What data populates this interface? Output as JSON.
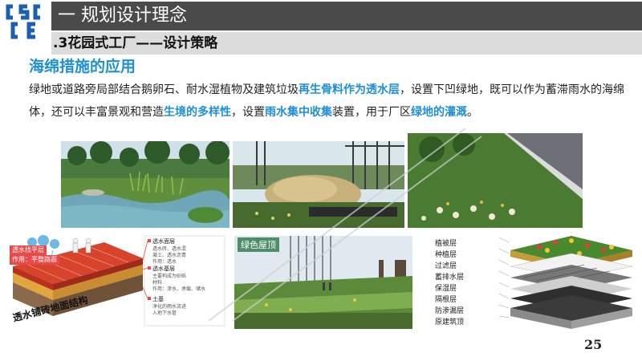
{
  "logo": {
    "text": "CSCEC"
  },
  "header": {
    "title": "一 规划设计理念"
  },
  "subheader": {
    "title": ".3花园式工厂——设计策略"
  },
  "section": {
    "title": "海绵措施的应用"
  },
  "paragraph": {
    "p1": "绿地或道路旁局部结合鹅卵石、耐水湿植物及建筑垃圾",
    "h1": "再生骨料作为透水层",
    "p2": "，设置下凹绿地，既可以作为蓄滞雨水的海绵体，还可以丰富景观和营造",
    "h2": "生境的多样性",
    "p3": "，设置",
    "h3": "雨水集中收集",
    "p4": "装置，用于厂区",
    "h4": "绿地的灌溉",
    "p5": "。"
  },
  "diagram_pavement": {
    "caption": "透水铺砖地面结构",
    "layers": [
      {
        "name": "透水面层",
        "note1": "透水砖、透水混",
        "note2": "凝土、透水沥青",
        "note3": "作用：透水"
      },
      {
        "name": "透水基层",
        "note1": "主要构成为砂砾",
        "note2": "材料",
        "note3": "作用：渗水、承载、储水"
      },
      {
        "name": "土基",
        "note1": "净化的雨水流进",
        "note2": "入地下水管"
      }
    ],
    "tags": [
      "透水找平层",
      "作用：平整路面"
    ]
  },
  "diagram_roof": {
    "photo_label": "绿色屋顶",
    "layers": [
      "植被层",
      "种植层",
      "过滤层",
      "蓄排水层",
      "保湿层",
      "隔根层",
      "防渗漏层",
      "原建筑顶"
    ]
  },
  "page": {
    "number": "25"
  },
  "colors": {
    "accent": "#1f8fd6",
    "header_bg": "#4a4a4a",
    "subheader_bg": "#dcdcdc",
    "logo": "#1a5fb0"
  }
}
